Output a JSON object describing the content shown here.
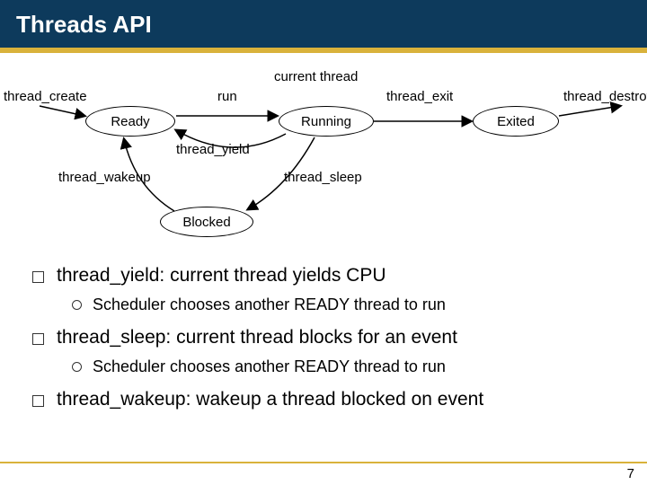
{
  "title": "Threads API",
  "diagram": {
    "states": {
      "ready": "Ready",
      "running": "Running",
      "exited": "Exited",
      "blocked": "Blocked"
    },
    "labels": {
      "create": "thread_create",
      "current": "current thread",
      "run": "run",
      "exit": "thread_exit",
      "destroy": "thread_destroy",
      "yield": "thread_yield",
      "wakeup": "thread_wakeup",
      "sleep": "thread_sleep"
    }
  },
  "bullets": [
    {
      "text": "thread_yield: current thread yields CPU",
      "subs": [
        "Scheduler chooses another READY thread to run"
      ]
    },
    {
      "text": "thread_sleep: current thread blocks for an event",
      "subs": [
        "Scheduler chooses another READY thread to run"
      ]
    },
    {
      "text": "thread_wakeup: wakeup a thread blocked on event",
      "subs": []
    }
  ],
  "page": "7"
}
